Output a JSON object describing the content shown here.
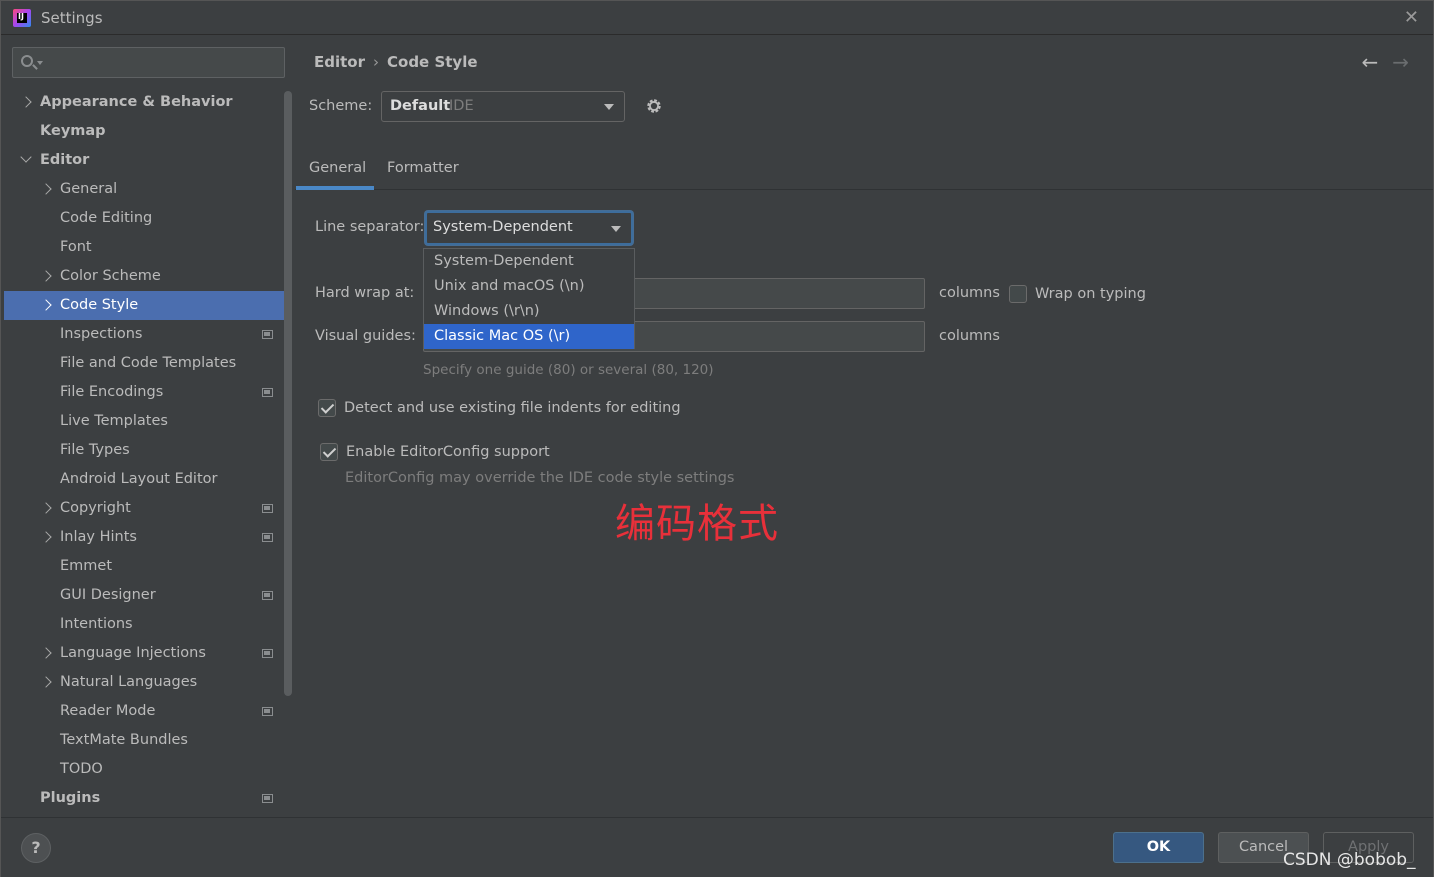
{
  "window": {
    "title": "Settings",
    "close_glyph": "✕"
  },
  "search": {
    "placeholder": ""
  },
  "sidebar": {
    "items": [
      {
        "label": "Appearance & Behavior",
        "level": 0,
        "chevron": "right",
        "bold": true
      },
      {
        "label": "Keymap",
        "level": 0,
        "chevron": "",
        "bold": true
      },
      {
        "label": "Editor",
        "level": 0,
        "chevron": "down",
        "bold": true
      },
      {
        "label": "General",
        "level": 1,
        "chevron": "right"
      },
      {
        "label": "Code Editing",
        "level": 1,
        "chevron": ""
      },
      {
        "label": "Font",
        "level": 1,
        "chevron": ""
      },
      {
        "label": "Color Scheme",
        "level": 1,
        "chevron": "right"
      },
      {
        "label": "Code Style",
        "level": 1,
        "chevron": "right",
        "selected": true
      },
      {
        "label": "Inspections",
        "level": 1,
        "chevron": "",
        "project_icon": true
      },
      {
        "label": "File and Code Templates",
        "level": 1,
        "chevron": ""
      },
      {
        "label": "File Encodings",
        "level": 1,
        "chevron": "",
        "project_icon": true
      },
      {
        "label": "Live Templates",
        "level": 1,
        "chevron": ""
      },
      {
        "label": "File Types",
        "level": 1,
        "chevron": ""
      },
      {
        "label": "Android Layout Editor",
        "level": 1,
        "chevron": ""
      },
      {
        "label": "Copyright",
        "level": 1,
        "chevron": "right",
        "project_icon": true
      },
      {
        "label": "Inlay Hints",
        "level": 1,
        "chevron": "right",
        "project_icon": true
      },
      {
        "label": "Emmet",
        "level": 1,
        "chevron": ""
      },
      {
        "label": "GUI Designer",
        "level": 1,
        "chevron": "",
        "project_icon": true
      },
      {
        "label": "Intentions",
        "level": 1,
        "chevron": ""
      },
      {
        "label": "Language Injections",
        "level": 1,
        "chevron": "right",
        "project_icon": true
      },
      {
        "label": "Natural Languages",
        "level": 1,
        "chevron": "right"
      },
      {
        "label": "Reader Mode",
        "level": 1,
        "chevron": "",
        "project_icon": true
      },
      {
        "label": "TextMate Bundles",
        "level": 1,
        "chevron": ""
      },
      {
        "label": "TODO",
        "level": 1,
        "chevron": ""
      },
      {
        "label": "Plugins",
        "level": 0,
        "chevron": "",
        "bold": true,
        "project_icon": true
      }
    ]
  },
  "main": {
    "breadcrumb": {
      "part1": "Editor",
      "separator": "›",
      "part2": "Code Style"
    },
    "nav": {
      "back": "←",
      "forward": "→"
    },
    "scheme": {
      "label": "Scheme:",
      "value": "Default",
      "suffix": "IDE"
    },
    "tabs": [
      {
        "label": "General",
        "active": true
      },
      {
        "label": "Formatter"
      }
    ],
    "line_separator": {
      "label": "Line separator:",
      "value": "System-Dependent",
      "options": [
        "System-Dependent",
        "Unix and macOS (\\n)",
        "Windows (\\r\\n)",
        "Classic Mac OS (\\r)"
      ],
      "highlighted_option": "Classic Mac OS (\\r)"
    },
    "hard_wrap": {
      "label": "Hard wrap at:",
      "value": "",
      "unit": "columns",
      "wrap_on_typing_label": "Wrap on typing",
      "wrap_on_typing": false
    },
    "visual_guides": {
      "label": "Visual guides:",
      "value": "",
      "unit": "columns",
      "hint": "Specify one guide (80) or several (80, 120)"
    },
    "detect_indents": {
      "label": "Detect and use existing file indents for editing",
      "checked": true
    },
    "editorconfig": {
      "label": "Enable EditorConfig support",
      "checked": true,
      "hint": "EditorConfig may override the IDE code style settings"
    },
    "annotation": "编码格式"
  },
  "footer": {
    "help": "?",
    "ok": "OK",
    "cancel": "Cancel",
    "apply": "Apply",
    "watermark": "CSDN @bobob_"
  },
  "colors": {
    "background": "#3c3f41",
    "selection": "#4b6eaf",
    "dropdown_selection": "#2f65ca",
    "tab_underline": "#4a88c7",
    "annotation": "#e8303a",
    "ok_button": "#365880"
  }
}
